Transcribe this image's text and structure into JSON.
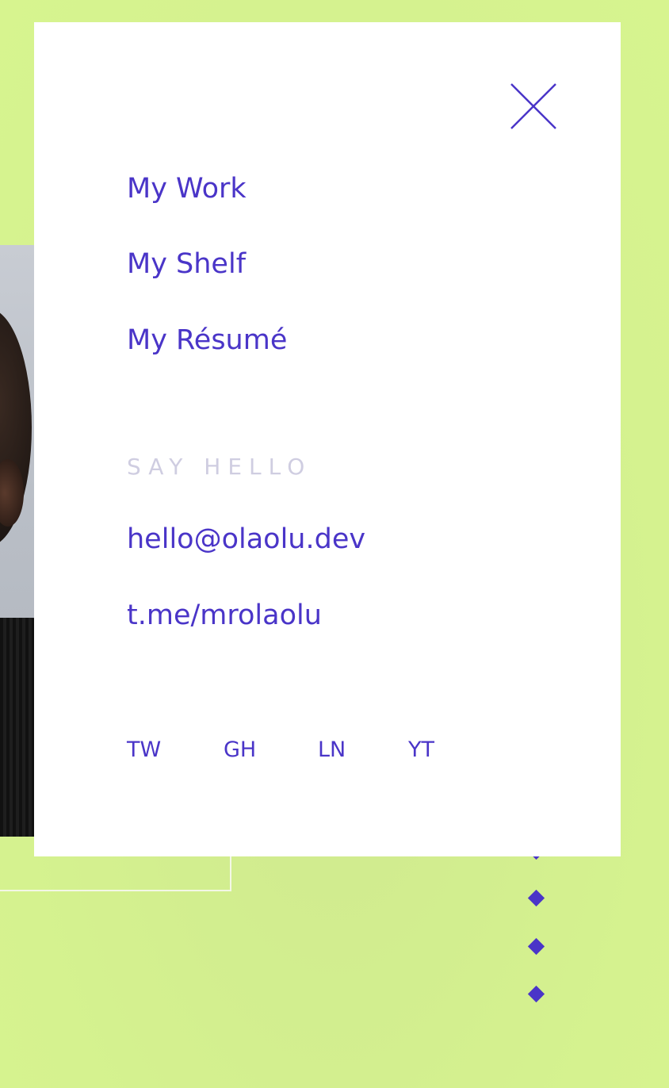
{
  "nav": {
    "items": [
      {
        "label": "My Work"
      },
      {
        "label": "My Shelf"
      },
      {
        "label": "My Résumé"
      }
    ]
  },
  "contact": {
    "heading": "SAY HELLO",
    "email": "hello@olaolu.dev",
    "telegram": "t.me/mrolaolu"
  },
  "social": [
    {
      "label": "TW"
    },
    {
      "label": "GH"
    },
    {
      "label": "LN"
    },
    {
      "label": "YT"
    }
  ],
  "colors": {
    "accent": "#4a35c8",
    "background": "#d5f28f",
    "muted": "#cfcde1",
    "panel": "#ffffff"
  },
  "icons": {
    "close": "close-icon"
  }
}
